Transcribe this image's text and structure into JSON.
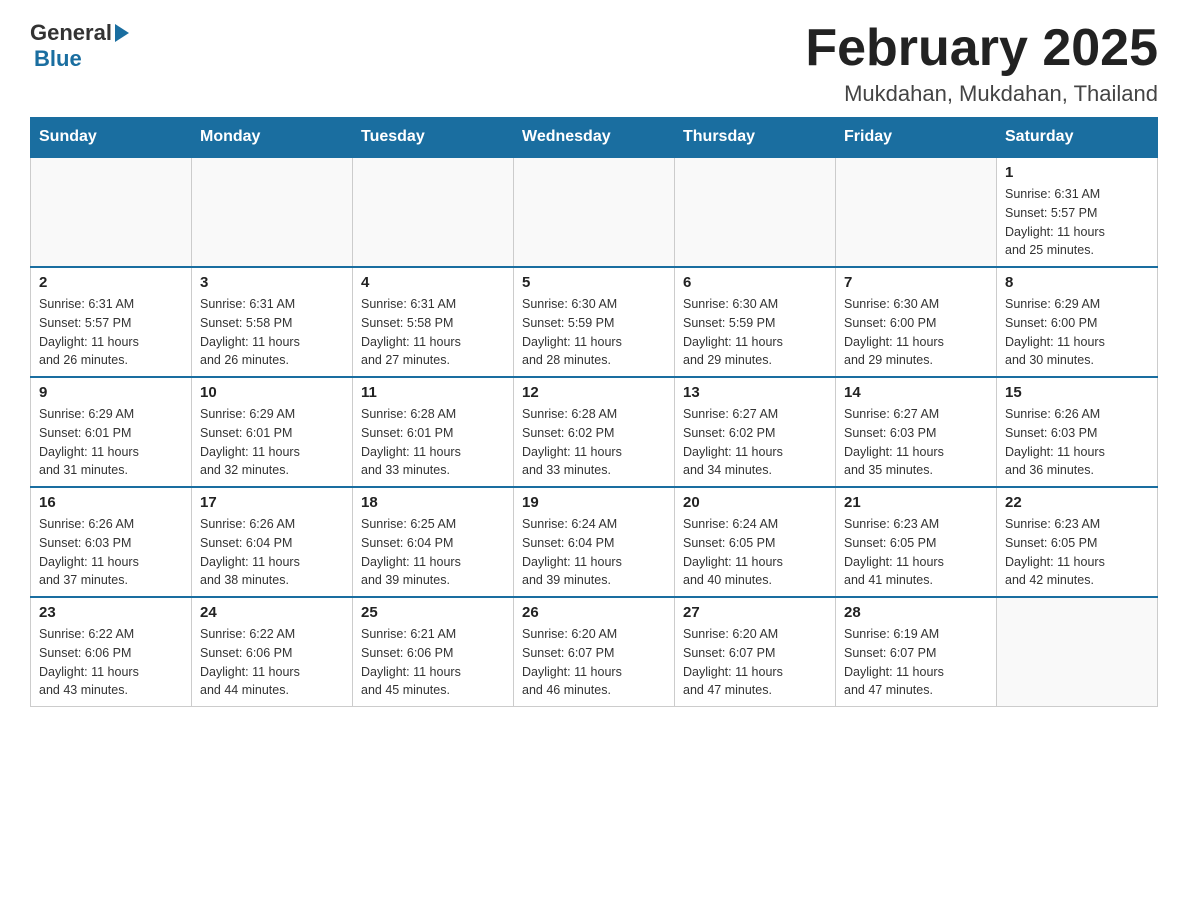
{
  "header": {
    "logo_general": "General",
    "logo_blue": "Blue",
    "month_title": "February 2025",
    "location": "Mukdahan, Mukdahan, Thailand"
  },
  "days_of_week": [
    "Sunday",
    "Monday",
    "Tuesday",
    "Wednesday",
    "Thursday",
    "Friday",
    "Saturday"
  ],
  "weeks": [
    {
      "days": [
        {
          "num": "",
          "info": ""
        },
        {
          "num": "",
          "info": ""
        },
        {
          "num": "",
          "info": ""
        },
        {
          "num": "",
          "info": ""
        },
        {
          "num": "",
          "info": ""
        },
        {
          "num": "",
          "info": ""
        },
        {
          "num": "1",
          "info": "Sunrise: 6:31 AM\nSunset: 5:57 PM\nDaylight: 11 hours\nand 25 minutes."
        }
      ]
    },
    {
      "days": [
        {
          "num": "2",
          "info": "Sunrise: 6:31 AM\nSunset: 5:57 PM\nDaylight: 11 hours\nand 26 minutes."
        },
        {
          "num": "3",
          "info": "Sunrise: 6:31 AM\nSunset: 5:58 PM\nDaylight: 11 hours\nand 26 minutes."
        },
        {
          "num": "4",
          "info": "Sunrise: 6:31 AM\nSunset: 5:58 PM\nDaylight: 11 hours\nand 27 minutes."
        },
        {
          "num": "5",
          "info": "Sunrise: 6:30 AM\nSunset: 5:59 PM\nDaylight: 11 hours\nand 28 minutes."
        },
        {
          "num": "6",
          "info": "Sunrise: 6:30 AM\nSunset: 5:59 PM\nDaylight: 11 hours\nand 29 minutes."
        },
        {
          "num": "7",
          "info": "Sunrise: 6:30 AM\nSunset: 6:00 PM\nDaylight: 11 hours\nand 29 minutes."
        },
        {
          "num": "8",
          "info": "Sunrise: 6:29 AM\nSunset: 6:00 PM\nDaylight: 11 hours\nand 30 minutes."
        }
      ]
    },
    {
      "days": [
        {
          "num": "9",
          "info": "Sunrise: 6:29 AM\nSunset: 6:01 PM\nDaylight: 11 hours\nand 31 minutes."
        },
        {
          "num": "10",
          "info": "Sunrise: 6:29 AM\nSunset: 6:01 PM\nDaylight: 11 hours\nand 32 minutes."
        },
        {
          "num": "11",
          "info": "Sunrise: 6:28 AM\nSunset: 6:01 PM\nDaylight: 11 hours\nand 33 minutes."
        },
        {
          "num": "12",
          "info": "Sunrise: 6:28 AM\nSunset: 6:02 PM\nDaylight: 11 hours\nand 33 minutes."
        },
        {
          "num": "13",
          "info": "Sunrise: 6:27 AM\nSunset: 6:02 PM\nDaylight: 11 hours\nand 34 minutes."
        },
        {
          "num": "14",
          "info": "Sunrise: 6:27 AM\nSunset: 6:03 PM\nDaylight: 11 hours\nand 35 minutes."
        },
        {
          "num": "15",
          "info": "Sunrise: 6:26 AM\nSunset: 6:03 PM\nDaylight: 11 hours\nand 36 minutes."
        }
      ]
    },
    {
      "days": [
        {
          "num": "16",
          "info": "Sunrise: 6:26 AM\nSunset: 6:03 PM\nDaylight: 11 hours\nand 37 minutes."
        },
        {
          "num": "17",
          "info": "Sunrise: 6:26 AM\nSunset: 6:04 PM\nDaylight: 11 hours\nand 38 minutes."
        },
        {
          "num": "18",
          "info": "Sunrise: 6:25 AM\nSunset: 6:04 PM\nDaylight: 11 hours\nand 39 minutes."
        },
        {
          "num": "19",
          "info": "Sunrise: 6:24 AM\nSunset: 6:04 PM\nDaylight: 11 hours\nand 39 minutes."
        },
        {
          "num": "20",
          "info": "Sunrise: 6:24 AM\nSunset: 6:05 PM\nDaylight: 11 hours\nand 40 minutes."
        },
        {
          "num": "21",
          "info": "Sunrise: 6:23 AM\nSunset: 6:05 PM\nDaylight: 11 hours\nand 41 minutes."
        },
        {
          "num": "22",
          "info": "Sunrise: 6:23 AM\nSunset: 6:05 PM\nDaylight: 11 hours\nand 42 minutes."
        }
      ]
    },
    {
      "days": [
        {
          "num": "23",
          "info": "Sunrise: 6:22 AM\nSunset: 6:06 PM\nDaylight: 11 hours\nand 43 minutes."
        },
        {
          "num": "24",
          "info": "Sunrise: 6:22 AM\nSunset: 6:06 PM\nDaylight: 11 hours\nand 44 minutes."
        },
        {
          "num": "25",
          "info": "Sunrise: 6:21 AM\nSunset: 6:06 PM\nDaylight: 11 hours\nand 45 minutes."
        },
        {
          "num": "26",
          "info": "Sunrise: 6:20 AM\nSunset: 6:07 PM\nDaylight: 11 hours\nand 46 minutes."
        },
        {
          "num": "27",
          "info": "Sunrise: 6:20 AM\nSunset: 6:07 PM\nDaylight: 11 hours\nand 47 minutes."
        },
        {
          "num": "28",
          "info": "Sunrise: 6:19 AM\nSunset: 6:07 PM\nDaylight: 11 hours\nand 47 minutes."
        },
        {
          "num": "",
          "info": ""
        }
      ]
    }
  ]
}
